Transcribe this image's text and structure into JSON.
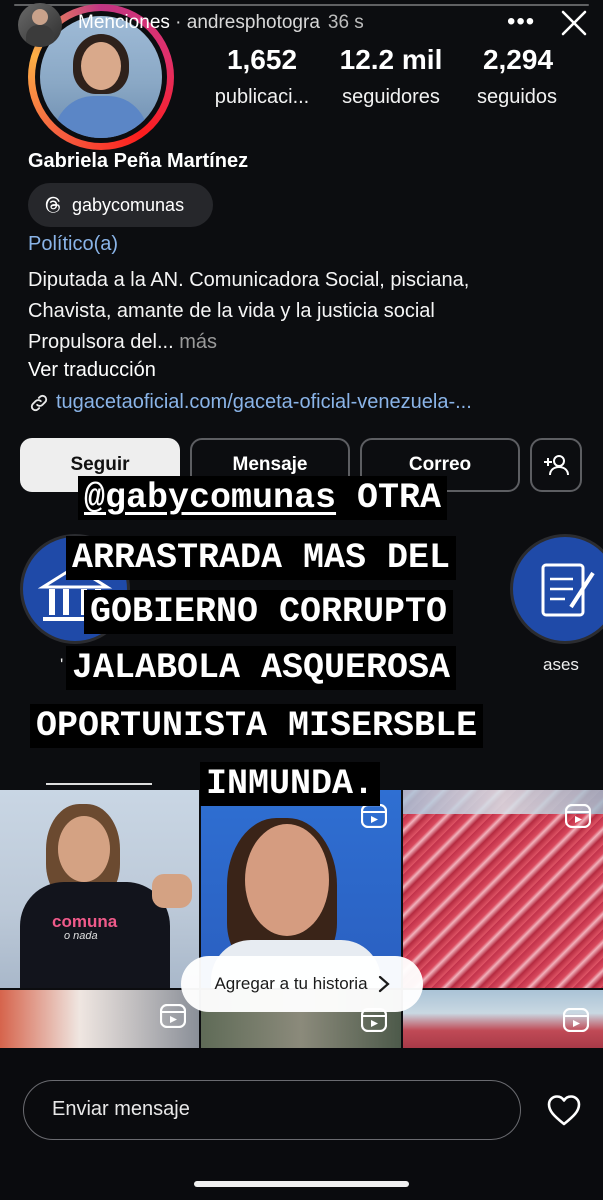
{
  "story": {
    "mentions_label": "Menciones",
    "separator": " · ",
    "username": "andresphotogra",
    "time": "36 s"
  },
  "profile": {
    "stats": [
      {
        "value": "1,652",
        "label": "publicaci..."
      },
      {
        "value": "12.2 mil",
        "label": "seguidores"
      },
      {
        "value": "2,294",
        "label": "seguidos"
      }
    ],
    "full_name": "Gabriela Peña Martínez",
    "threads_handle": "gabycomunas",
    "category": "Político(a)",
    "bio_line1": "Diputada a la AN. Comunicadora Social, pisciana,",
    "bio_line2": "Chavista, amante de la vida y la justicia social",
    "bio_line3": "Propulsora del",
    "bio_ellipsis": "... ",
    "bio_more": "más",
    "translate": "Ver traducción",
    "link": "tugacetaoficial.com/gaceta-oficial-venezuela-..."
  },
  "buttons": {
    "follow": "Seguir",
    "message": "Mensaje",
    "email": "Correo"
  },
  "highlights": {
    "left_partial": "'",
    "right_partial": "ases"
  },
  "overlay_text": {
    "mention": "@gabycomunas",
    "line1_rest": " OTRA",
    "line2": "ARRASTRADA MAS DEL",
    "line3": "GOBIERNO CORRUPTO",
    "line4": "JALABOLA ASQUEROSA",
    "line5": "OPORTUNISTA MISERSBLE",
    "line6": "INMUNDA."
  },
  "grid": {
    "shirt_text": "comuna",
    "shirt_sub": "o nada"
  },
  "add_to_story": "Agregar a tu historia",
  "bottom": {
    "send_message_placeholder": "Enviar mensaje"
  },
  "colors": {
    "link": "#8ab4e8",
    "background": "#0c0d10",
    "highlight_blue": "#1f4aa8"
  }
}
